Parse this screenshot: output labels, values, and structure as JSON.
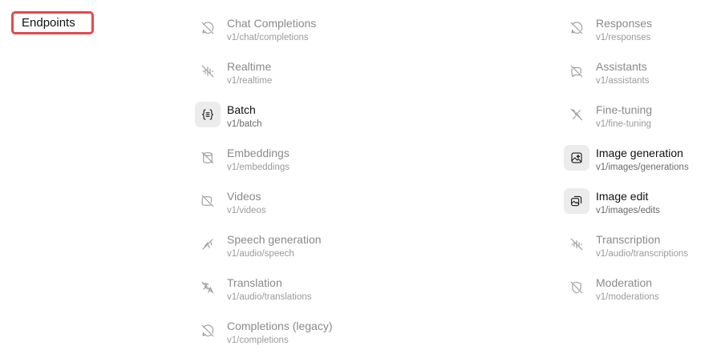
{
  "section": {
    "label": "Endpoints"
  },
  "endpoints": [
    {
      "name": "Chat Completions",
      "path": "v1/chat/completions",
      "supported": false,
      "icon": "chat-off-icon"
    },
    {
      "name": "Realtime",
      "path": "v1/realtime",
      "supported": false,
      "icon": "realtime-off-icon"
    },
    {
      "name": "Batch",
      "path": "v1/batch",
      "supported": true,
      "icon": "batch-icon"
    },
    {
      "name": "Embeddings",
      "path": "v1/embeddings",
      "supported": false,
      "icon": "embeddings-off-icon"
    },
    {
      "name": "Videos",
      "path": "v1/videos",
      "supported": false,
      "icon": "video-off-icon"
    },
    {
      "name": "Speech generation",
      "path": "v1/audio/speech",
      "supported": false,
      "icon": "speech-off-icon"
    },
    {
      "name": "Translation",
      "path": "v1/audio/translations",
      "supported": false,
      "icon": "translation-off-icon"
    },
    {
      "name": "Completions (legacy)",
      "path": "v1/completions",
      "supported": false,
      "icon": "completions-off-icon"
    },
    {
      "name": "Responses",
      "path": "v1/responses",
      "supported": false,
      "icon": "responses-off-icon"
    },
    {
      "name": "Assistants",
      "path": "v1/assistants",
      "supported": false,
      "icon": "assistants-off-icon"
    },
    {
      "name": "Fine-tuning",
      "path": "v1/fine-tuning",
      "supported": false,
      "icon": "fine-tuning-off-icon"
    },
    {
      "name": "Image generation",
      "path": "v1/images/generations",
      "supported": true,
      "icon": "image-generation-icon"
    },
    {
      "name": "Image edit",
      "path": "v1/images/edits",
      "supported": true,
      "icon": "image-edit-icon"
    },
    {
      "name": "Transcription",
      "path": "v1/audio/transcriptions",
      "supported": false,
      "icon": "transcription-off-icon"
    },
    {
      "name": "Moderation",
      "path": "v1/moderations",
      "supported": false,
      "icon": "moderation-off-icon"
    }
  ],
  "colors": {
    "highlight_border": "#e5484d",
    "supported_text": "#111111",
    "unsupported_text": "#8a8a8a",
    "supported_icon_bg": "#ececec"
  }
}
